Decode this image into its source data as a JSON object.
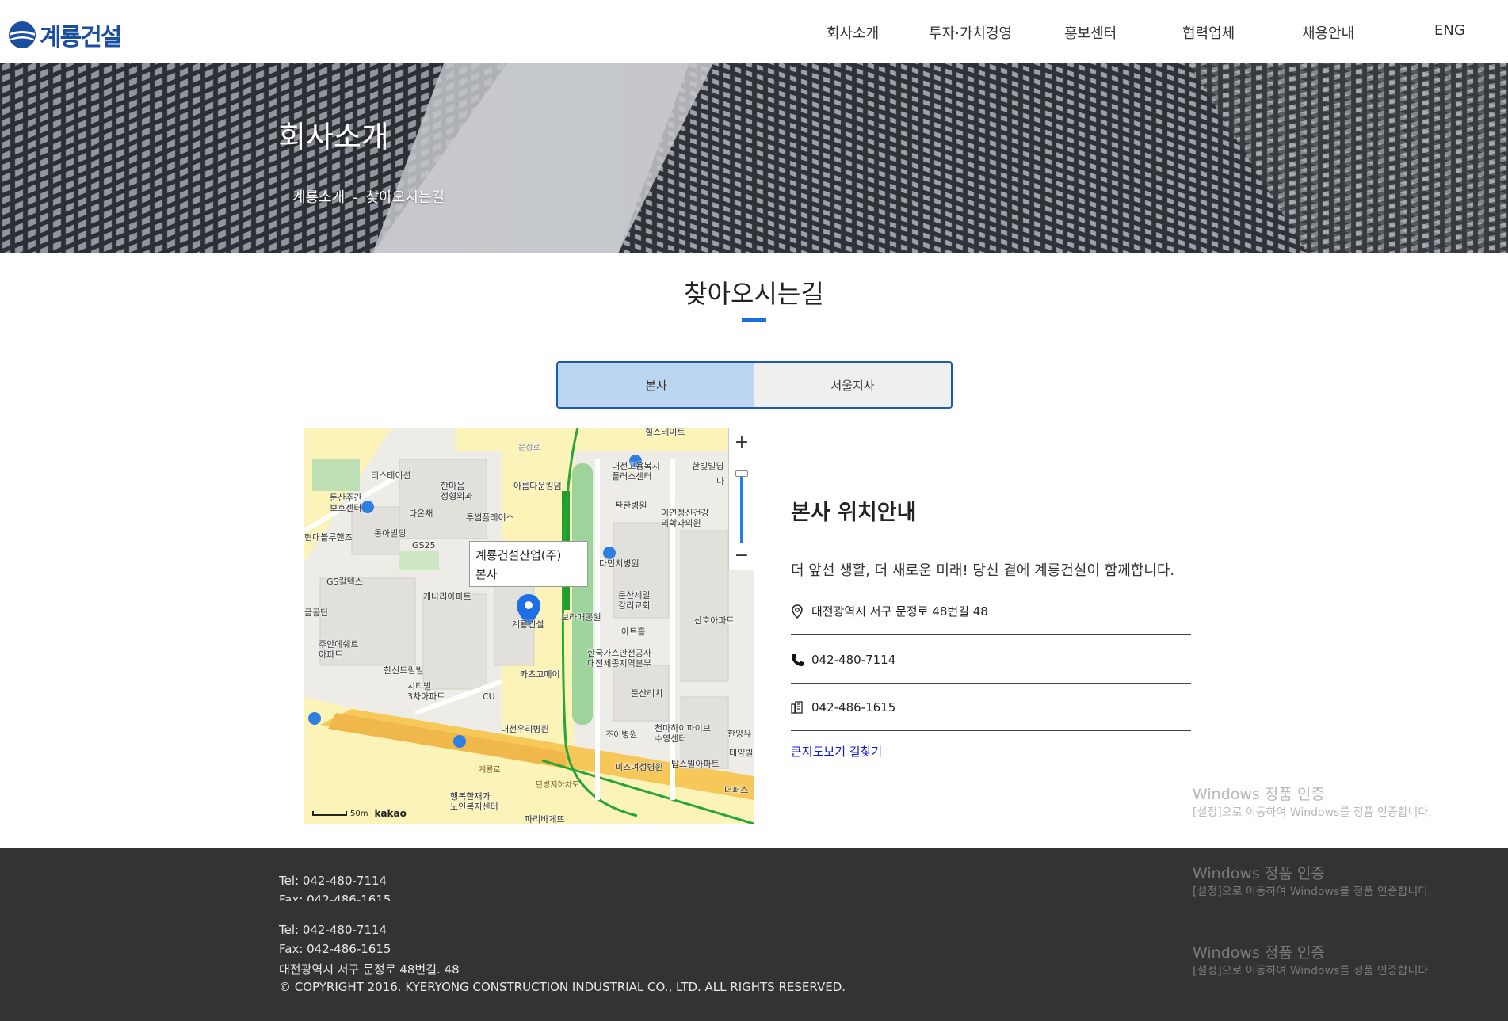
{
  "header": {
    "logo_text": "계룡건설",
    "nav": [
      "회사소개",
      "투자·가치경영",
      "홍보센터",
      "협력업체",
      "채용안내",
      "ENG"
    ]
  },
  "hero": {
    "title": "회사소개",
    "breadcrumb": [
      "계룡소개",
      "-",
      "찾아오시는길"
    ]
  },
  "section": {
    "title": "찾아오시는길"
  },
  "tabs": [
    {
      "label": "본사",
      "active": true
    },
    {
      "label": "서울지사",
      "active": false
    }
  ],
  "map": {
    "popup_line1": "계룡건설산업(주)",
    "popup_line2": "본사",
    "zoom_in": "+",
    "zoom_out": "−",
    "scale": "50m",
    "provider": "kakao",
    "labels": {
      "hillstate": "힐스테이트",
      "munjeongro": "문정로",
      "tistation": "티스테이션",
      "hanmaeum": "한마음\n정형외과",
      "areumdaun": "아름다운킹덤",
      "daejeon_welfare": "대전고용복지\n플러스센터",
      "hanbit": "한빛빌딩",
      "dunsan_care": "둔산주간\n보호센터",
      "dawon": "다온채",
      "tuseom": "투썸플레이스",
      "tantan": "탄탄병원",
      "iyeon": "이연정신건강\n의학과의원",
      "hyundai_blue": "현대블루핸즈",
      "dongaa": "동아빌딩",
      "gs25": "GS25",
      "daeminchi": "다민치병원",
      "gscaltex": "GS칼텍스",
      "gaenari": "개나리아파트",
      "dunsan_church": "둔산제일\n감리교회",
      "geumgongdan": "금공단",
      "gyeryong": "계룡건설",
      "borame": "보라매공원",
      "sanho": "산호아파트",
      "arthome": "아트홈",
      "juan": "주안에쉐르\n아파트",
      "hanshin": "한신드림빌",
      "gas_safety": "한국가스안전공사\n대전세종지역본부",
      "kazgomei": "카츠고메이",
      "sitibil": "시티빌\n3차아파트",
      "cu": "CU",
      "dunsanrich": "둔산리치",
      "daejeon_uri": "대전우리병원",
      "joi": "조이병원",
      "cheonma": "천마하이파이브\n수영센터",
      "hanyang": "한양유",
      "taeyang": "태양빌",
      "miz": "미즈여성병원",
      "tops": "탑스빌아파트",
      "gyeryongro": "계룡로",
      "tanbang": "탄방지하차도",
      "deopaeseu": "더퍼스",
      "haengbok": "행복한재가\n노인복지센터",
      "paris": "파리바게뜨",
      "na": "나"
    }
  },
  "info": {
    "title": "본사 위치안내",
    "description": "더 앞선 생활, 더 새로운 미래! 당신 곁에 계룡건설이 함께합니다.",
    "address": "대전광역시 서구 문정로 48번길 48",
    "phone": "042-480-7114",
    "fax": "042-486-1615",
    "link": "큰지도보기 길찾기"
  },
  "watermark": {
    "title": "Windows 정품 인증",
    "subtitle": "[설정]으로 이동하여 Windows를 정품 인증합니다."
  },
  "footer": {
    "clip_tel": "Tel: 042-480-7114",
    "clip_fax": "Fax: 042-486-1615",
    "tel": "Tel: 042-480-7114",
    "fax": "Fax: 042-486-1615",
    "address": "대전광역시 서구 문정로 48번길. 48",
    "copyright": "© COPYRIGHT 2016. KYERYONG CONSTRUCTION INDUSTRIAL CO., LTD. ALL RIGHTS RESERVED."
  },
  "colors": {
    "accent": "#1a6fd8",
    "tab_active": "#bcd6f1",
    "tab_border": "#1a5bb0",
    "footer_bg": "#333333",
    "link": "#1515d4"
  }
}
